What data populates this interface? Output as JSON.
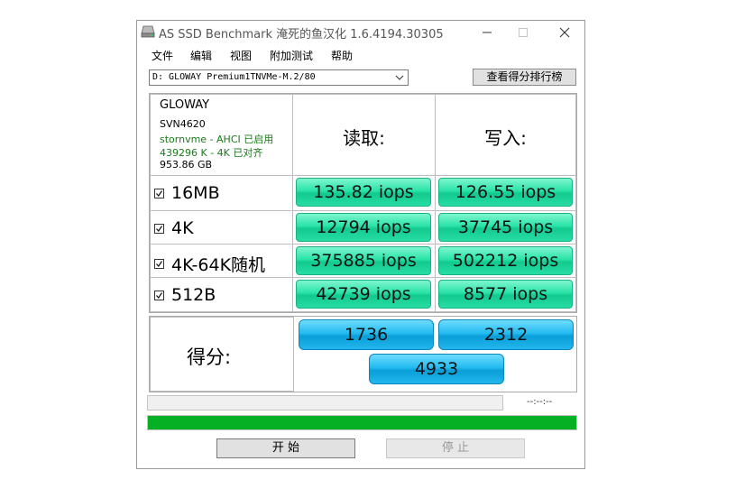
{
  "window": {
    "title": "AS SSD Benchmark 淹死的鱼汉化 1.6.4194.30305",
    "controls": [
      "minimize",
      "maximize",
      "close"
    ]
  },
  "menu": [
    "文件",
    "编辑",
    "视图",
    "附加测试",
    "帮助"
  ],
  "drive": {
    "selected": "D: GLOWAY Premium1TNVMe-M.2/80",
    "rank_button": "查看得分排行榜"
  },
  "info": {
    "model": "GLOWAY",
    "firmware": "SVN4620",
    "driver": "stornvme - AHCI 已启用",
    "alignment": "439296 K - 4K 已对齐",
    "size": "953.86 GB"
  },
  "headers": {
    "read": "读取:",
    "write": "写入:"
  },
  "rows": [
    {
      "label": "16MB",
      "checked": true,
      "read": "135.82 iops",
      "write": "126.55 iops"
    },
    {
      "label": "4K",
      "checked": true,
      "read": "12794 iops",
      "write": "37745 iops"
    },
    {
      "label": "4K-64K随机",
      "checked": true,
      "read": "375885 iops",
      "write": "502212 iops"
    },
    {
      "label": "512B",
      "checked": true,
      "read": "42739 iops",
      "write": "8577 iops"
    }
  ],
  "score": {
    "label": "得分:",
    "read": "1736",
    "write": "2312",
    "total": "4933"
  },
  "progress": {
    "time": "--:--:--",
    "fraction": 1.0
  },
  "buttons": {
    "start": "开 始",
    "stop": "停 止"
  },
  "colors": {
    "result_green": "#29e3a8",
    "score_blue": "#23baf0",
    "progress_green": "#06b025",
    "info_green": "#1a7a1a"
  }
}
